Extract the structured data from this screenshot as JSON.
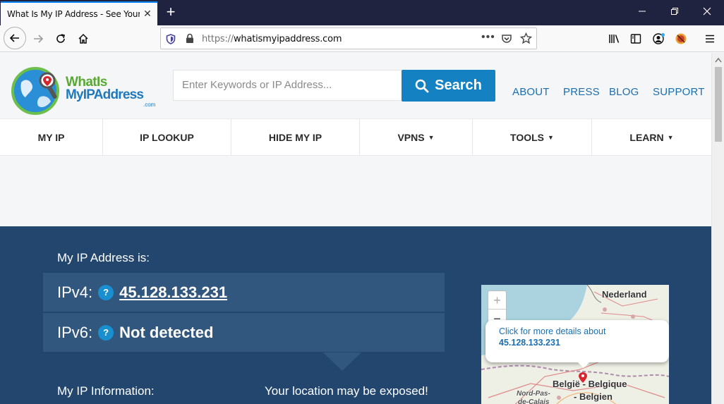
{
  "browser": {
    "tab_title": "What Is My IP Address - See Your Pu",
    "url_scheme": "https://",
    "url_host": "whatismyipaddress.com"
  },
  "site": {
    "logo": {
      "line1": "WhatIs",
      "line2": "MyIPAddress",
      "line3": ".com"
    },
    "search": {
      "placeholder": "Enter Keywords or IP Address...",
      "button_label": "Search"
    },
    "top_links": [
      "ABOUT",
      "PRESS",
      "BLOG",
      "SUPPORT"
    ],
    "nav": [
      {
        "label": "MY IP",
        "caret": false
      },
      {
        "label": "IP LOOKUP",
        "caret": false
      },
      {
        "label": "HIDE MY IP",
        "caret": false
      },
      {
        "label": "VPNS",
        "caret": true
      },
      {
        "label": "TOOLS",
        "caret": true
      },
      {
        "label": "LEARN",
        "caret": true
      }
    ]
  },
  "ip_panel": {
    "heading": "My IP Address is:",
    "ipv4_label": "IPv4:",
    "ipv4_value": "45.128.133.231",
    "ipv6_label": "IPv6:",
    "ipv6_value": "Not detected",
    "help_glyph": "?",
    "info_label": "My IP Information:",
    "exposed_text": "Your location may be exposed!"
  },
  "map": {
    "popup_text": "Click for more details about",
    "popup_ip": "45.128.133.231",
    "labels": [
      "Nederland",
      "België - Belgique",
      "- Belgien",
      "Nord-Pas-",
      "de-Calais"
    ],
    "zoom_in": "+",
    "zoom_out": "−"
  },
  "colors": {
    "hero_bg": "#22466e",
    "accent_blue": "#1481c2",
    "link_blue": "#1b6fb0"
  }
}
